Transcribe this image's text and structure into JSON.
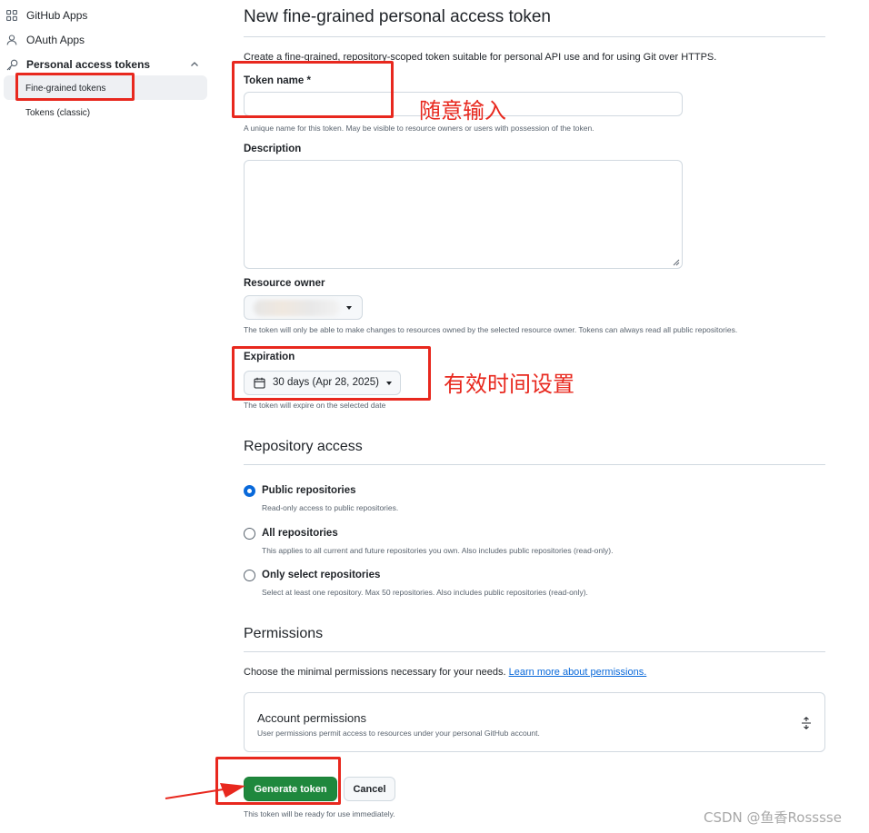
{
  "sidebar": {
    "github_apps": "GitHub Apps",
    "oauth_apps": "OAuth Apps",
    "personal_access_tokens": "Personal access tokens",
    "fine_grained_tokens": "Fine-grained tokens",
    "tokens_classic": "Tokens (classic)"
  },
  "page": {
    "title": "New fine-grained personal access token",
    "subtitle": "Create a fine-grained, repository-scoped token suitable for personal API use and for using Git over HTTPS."
  },
  "form": {
    "token_name_label": "Token name *",
    "token_name_value": "",
    "token_name_note": "A unique name for this token. May be visible to resource owners or users with possession of the token.",
    "description_label": "Description",
    "description_value": "",
    "resource_owner_label": "Resource owner",
    "resource_owner_note": "The token will only be able to make changes to resources owned by the selected resource owner. Tokens can always read all public repositories.",
    "expiration_label": "Expiration",
    "expiration_value": "30 days (Apr 28, 2025)",
    "expiration_note": "The token will expire on the selected date"
  },
  "repository_access": {
    "heading": "Repository access",
    "options": [
      {
        "label": "Public repositories",
        "desc": "Read-only access to public repositories.",
        "selected": true
      },
      {
        "label": "All repositories",
        "desc": "This applies to all current and future repositories you own. Also includes public repositories (read-only).",
        "selected": false
      },
      {
        "label": "Only select repositories",
        "desc": "Select at least one repository. Max 50 repositories. Also includes public repositories (read-only).",
        "selected": false
      }
    ]
  },
  "permissions": {
    "heading": "Permissions",
    "intro": "Choose the minimal permissions necessary for your needs.",
    "learn_more": "Learn more about permissions.",
    "account_title": "Account permissions",
    "account_desc": "User permissions permit access to resources under your personal GitHub account."
  },
  "actions": {
    "generate": "Generate token",
    "cancel": "Cancel",
    "note": "This token will be ready for use immediately."
  },
  "annotations": {
    "token_name_hint": "随意输入",
    "expiration_hint": "有效时间设置"
  },
  "watermark": "CSDN @鱼香Rosssse",
  "colors": {
    "primary": "#1f883d",
    "link": "#0969da",
    "annotation": "#e8281e"
  }
}
